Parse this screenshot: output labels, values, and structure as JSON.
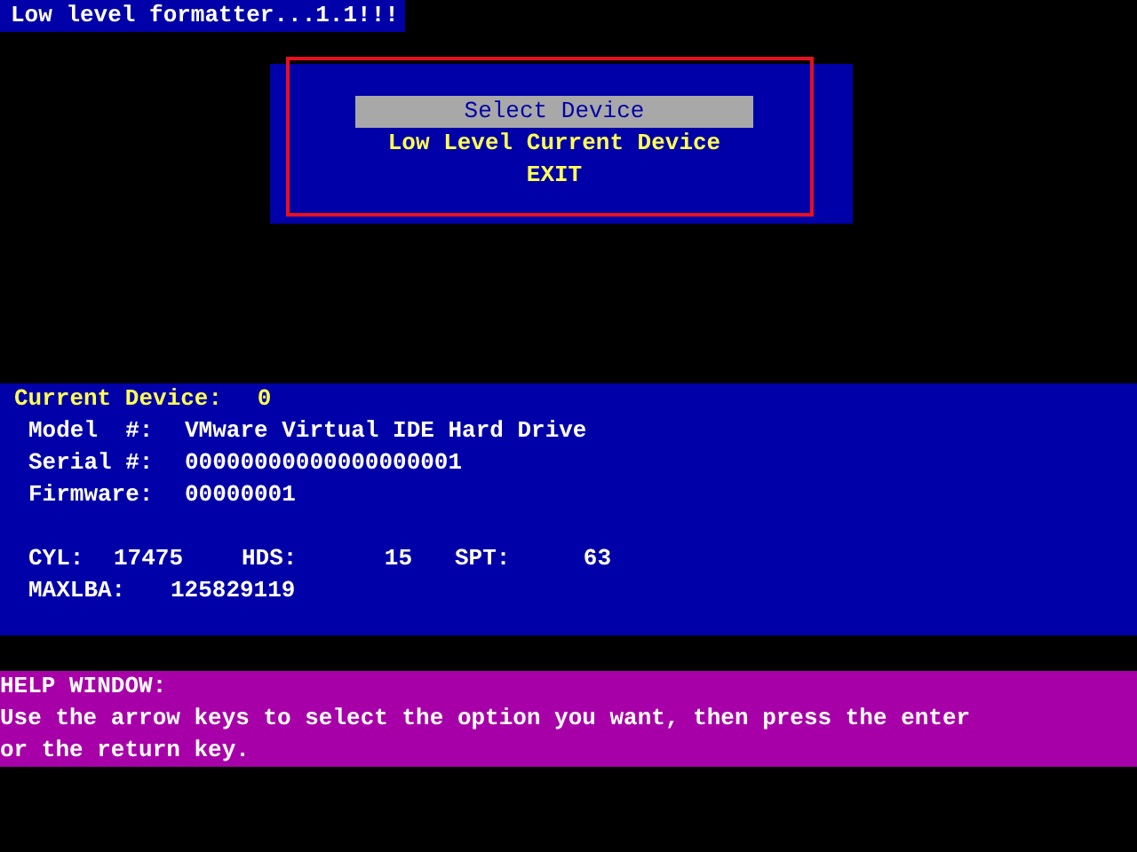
{
  "title": "Low level formatter...1.1!!!",
  "menu": {
    "items": [
      {
        "label": "Select Device",
        "selected": true
      },
      {
        "label": "Low Level Current Device",
        "selected": false
      },
      {
        "label": "EXIT",
        "selected": false
      }
    ],
    "highlighted": true
  },
  "device": {
    "heading": {
      "label": "Current Device:",
      "value": "0"
    },
    "rows": [
      [
        {
          "label": "Model  #:",
          "value": "VMware Virtual IDE Hard Drive"
        }
      ],
      [
        {
          "label": "Serial #:",
          "value": "00000000000000000001"
        }
      ],
      [
        {
          "label": "Firmware:",
          "value": "00000001"
        }
      ],
      [],
      [
        {
          "label": "CYL:",
          "value": "17475"
        },
        {
          "label": "HDS:",
          "value": "15"
        },
        {
          "label": "SPT:",
          "value": "63"
        }
      ],
      [
        {
          "label": "MAXLBA:",
          "value": "125829119"
        }
      ]
    ]
  },
  "help": {
    "title": "HELP WINDOW:",
    "lines": [
      "Use the arrow keys to select the option you want, then press the enter",
      "or the return key."
    ]
  }
}
